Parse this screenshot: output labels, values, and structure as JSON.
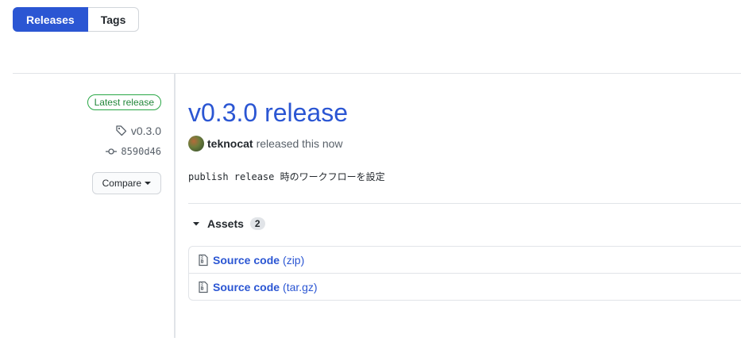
{
  "tabs": [
    {
      "label": "Releases",
      "active": true
    },
    {
      "label": "Tags",
      "active": false
    }
  ],
  "release": {
    "badge": "Latest release",
    "tag": "v0.3.0",
    "commit": "8590d46",
    "compare_label": "Compare",
    "title": "v0.3.0 release",
    "author": "teknocat",
    "author_suffix": "released this now",
    "body": "publish release 時のワークフローを設定"
  },
  "assets": {
    "label": "Assets",
    "count": "2",
    "items": [
      {
        "name": "Source code",
        "ext": "(zip)",
        "icon": "file-zip-icon"
      },
      {
        "name": "Source code",
        "ext": "(tar.gz)",
        "icon": "file-zip-icon"
      }
    ]
  },
  "colors": {
    "accent": "#2b56d3",
    "badge_green": "#22863a",
    "border": "#e1e4e8"
  }
}
